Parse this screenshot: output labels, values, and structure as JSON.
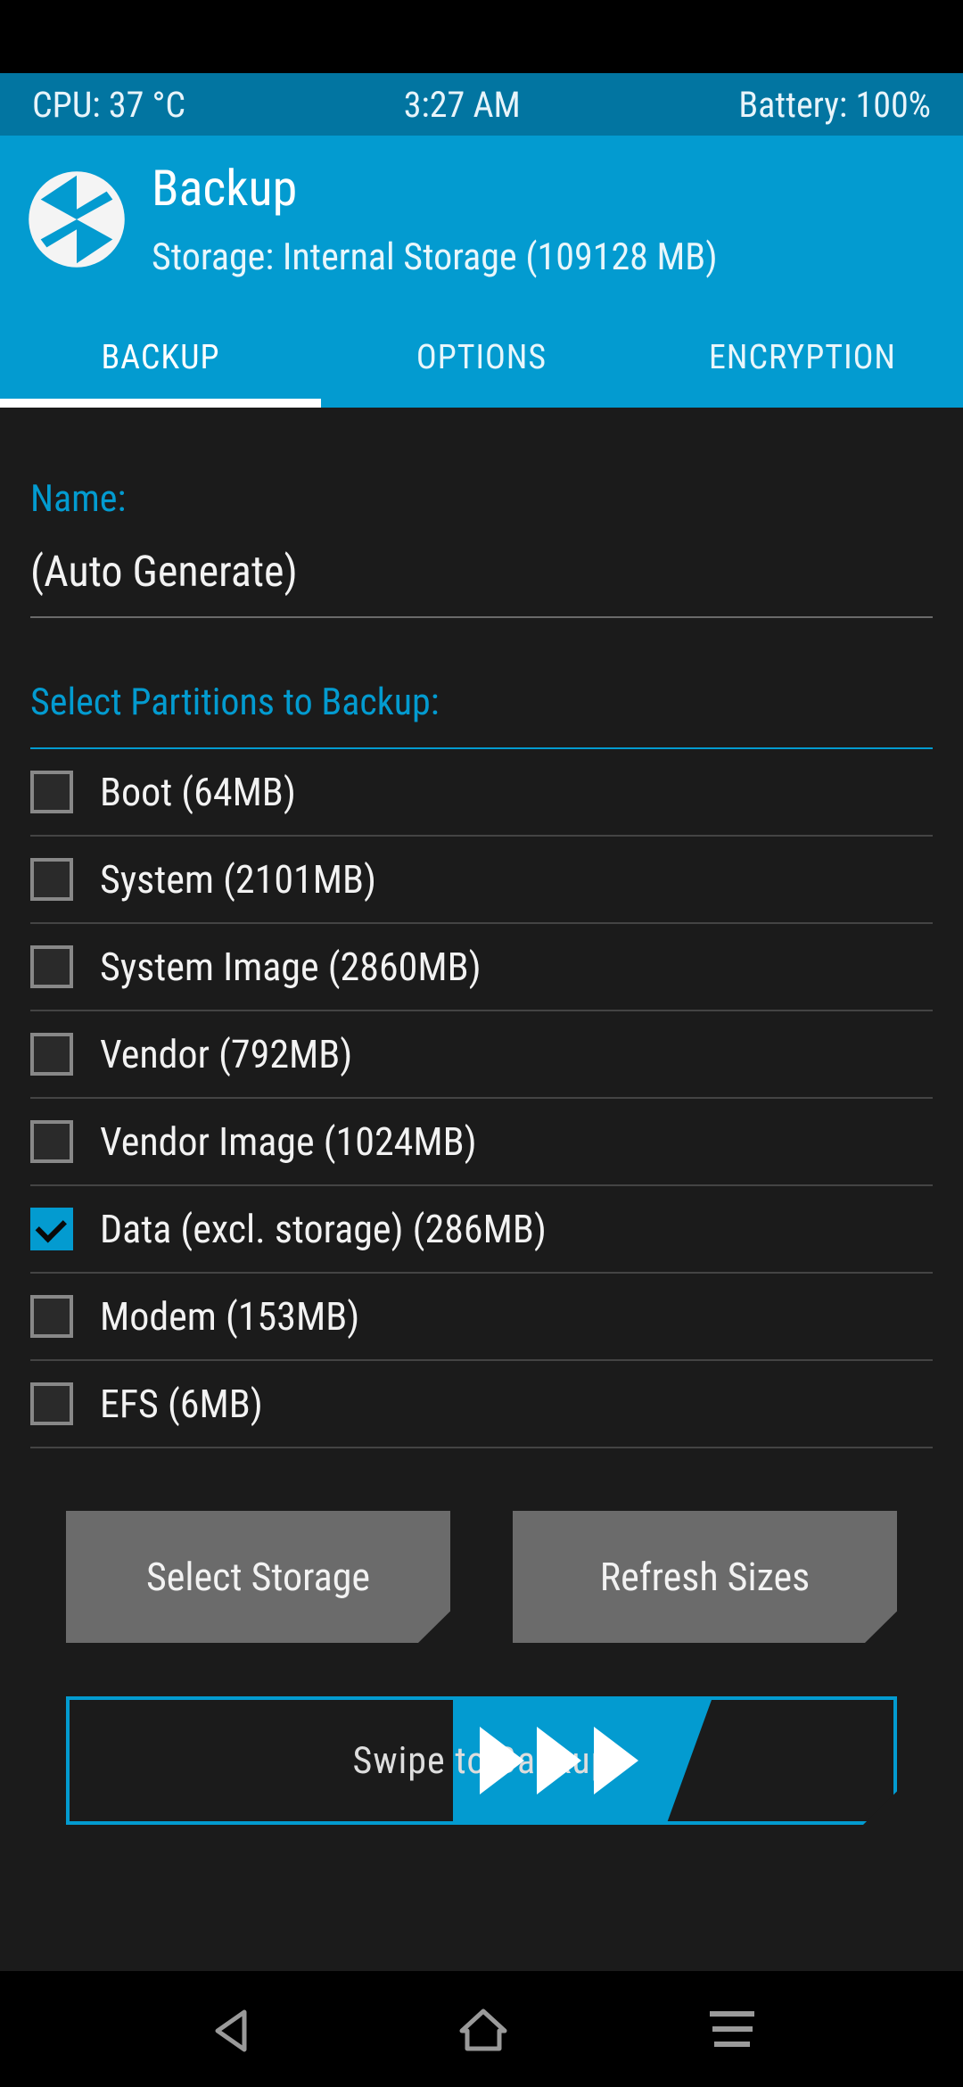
{
  "status": {
    "cpu": "CPU: 37 °C",
    "time": "3:27 AM",
    "battery": "Battery: 100%"
  },
  "header": {
    "title": "Backup",
    "subtitle": "Storage: Internal Storage (109128 MB)"
  },
  "tabs": {
    "backup": "BACKUP",
    "options": "OPTIONS",
    "encryption": "ENCRYPTION",
    "active": "backup"
  },
  "name_field": {
    "label": "Name:",
    "value": "(Auto Generate)"
  },
  "partitions": {
    "label": "Select Partitions to Backup:",
    "items": [
      {
        "label": "Boot (64MB)",
        "checked": false
      },
      {
        "label": "System (2101MB)",
        "checked": false
      },
      {
        "label": "System Image (2860MB)",
        "checked": false
      },
      {
        "label": "Vendor (792MB)",
        "checked": false
      },
      {
        "label": "Vendor Image (1024MB)",
        "checked": false
      },
      {
        "label": "Data (excl. storage) (286MB)",
        "checked": true
      },
      {
        "label": "Modem (153MB)",
        "checked": false
      },
      {
        "label": "EFS (6MB)",
        "checked": false
      }
    ]
  },
  "buttons": {
    "select_storage": "Select Storage",
    "refresh_sizes": "Refresh Sizes"
  },
  "swipe": {
    "label": "Swipe to Backup"
  },
  "colors": {
    "accent": "#039bd0",
    "statusbar": "#0275a1",
    "bg": "#1b1b1b",
    "button": "#6b6b6b"
  }
}
